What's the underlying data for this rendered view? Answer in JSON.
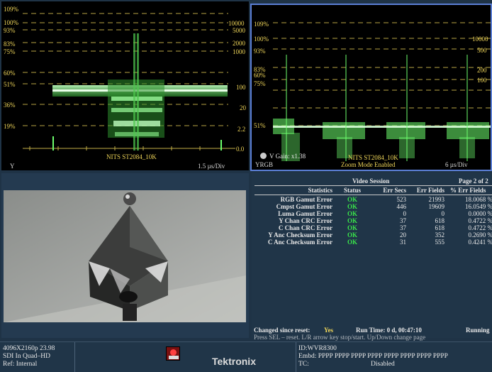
{
  "waveform_left": {
    "scale_left": [
      "109%",
      "100%",
      "93%",
      "83%",
      "75%",
      "60%",
      "51%",
      "36%",
      "19%"
    ],
    "scale_right": [
      "10000",
      "5000",
      "2000",
      "1000",
      "100",
      "20",
      "2.2",
      "0.0"
    ],
    "channel_label": "Y",
    "standard_label": "NITS  ST2084_10K",
    "time_div": "1.5 µs/Div"
  },
  "waveform_right": {
    "scale_left": [
      "109%",
      "100%",
      "93%",
      "83%",
      "60%",
      "75%",
      "51%"
    ],
    "scale_right": [
      "10000",
      "500",
      "200",
      "100"
    ],
    "gain_label": "V Gain: x1.38",
    "channel_label": "YRGB",
    "standard_label": "NITS  ST2084_10K",
    "zoom_label": "Zoom Mode Enabled",
    "time_div": "6 µs/Div"
  },
  "session": {
    "title": "Video Session",
    "page": "Page 2 of 2",
    "headers": [
      "Statistics",
      "Status",
      "Err Secs",
      "Err Fields",
      "% Err Fields"
    ],
    "rows": [
      {
        "name": "RGB Gamut Error",
        "status": "OK",
        "secs": "523",
        "fields": "21993",
        "pct": "18.0068 %"
      },
      {
        "name": "Cmpst Gamut Error",
        "status": "OK",
        "secs": "446",
        "fields": "19609",
        "pct": "16.0549 %"
      },
      {
        "name": "Luma Gamut Error",
        "status": "OK",
        "secs": "0",
        "fields": "0",
        "pct": "0.0000 %"
      },
      {
        "name": "Y Chan CRC Error",
        "status": "OK",
        "secs": "37",
        "fields": "618",
        "pct": "0.4722 %"
      },
      {
        "name": "C Chan CRC Error",
        "status": "OK",
        "secs": "37",
        "fields": "618",
        "pct": "0.4722 %"
      },
      {
        "name": "Y Anc Checksum Error",
        "status": "OK",
        "secs": "20",
        "fields": "352",
        "pct": "0.2690 %"
      },
      {
        "name": "C Anc Checksum Error",
        "status": "OK",
        "secs": "31",
        "fields": "555",
        "pct": "0.4241 %"
      }
    ],
    "changed_label": "Changed since reset:",
    "changed_value": "Yes",
    "run_time": "Run Time: 0 d, 00:47:10",
    "run_state": "Running",
    "hint": "Press SEL – reset. L/R arrow key stop/start. Up/Down change page"
  },
  "status_bar": {
    "format": "4096X2160p 23.98",
    "link": "SDI In Quad–HD",
    "ref": "Ref: Internal",
    "brand": "Tektronix",
    "id": "ID:WVR8300",
    "embd": "Embd: PPPP PPPP PPPP PPPP PPPP PPPP PPPP PPPP",
    "tc_label": "TC:",
    "tc_value": "Disabled"
  },
  "colors": {
    "trace": "#6dff6d",
    "scale": "#f2d85a",
    "ok": "#39e34a",
    "focus_border": "#5b7fd6"
  }
}
